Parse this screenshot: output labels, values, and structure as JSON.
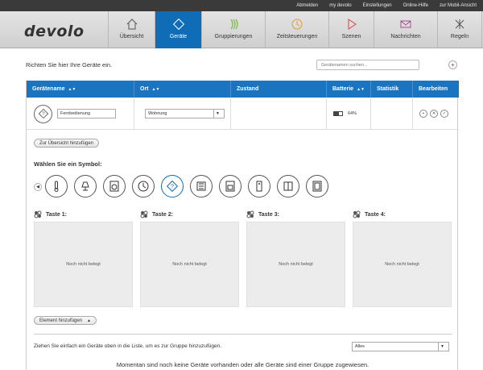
{
  "topbar": {
    "links": [
      "Abmelden",
      "my devolo",
      "Einstellungen",
      "Online-Hilfe",
      "zur Mobil-Ansicht"
    ]
  },
  "logo": "devolo",
  "tabs": [
    {
      "label": "Übersicht",
      "icon": "home-icon"
    },
    {
      "label": "Geräte",
      "icon": "device-icon",
      "active": true
    },
    {
      "label": "Gruppierungen",
      "icon": "groups-icon"
    },
    {
      "label": "Zeitsteuerungen",
      "icon": "clock-icon"
    },
    {
      "label": "Szenen",
      "icon": "play-icon"
    },
    {
      "label": "Nachrichten",
      "icon": "mail-icon"
    },
    {
      "label": "Regeln",
      "icon": "rules-icon"
    }
  ],
  "intro": "Richten Sie hier Ihre Geräte ein.",
  "search": {
    "placeholder": "Gerätenamen suchen..."
  },
  "table": {
    "headers": [
      "Gerätename",
      "Ort",
      "Zustand",
      "Batterie",
      "Statistik",
      "Bearbeiten"
    ],
    "row": {
      "name": "Fernbedienung",
      "location": "Wohnung",
      "battery_text": "64%",
      "battery_level": 0.64
    }
  },
  "add_overview_label": "Zur Übersicht hinzufügen",
  "symbols": {
    "title": "Wählen Sie ein Symbol:",
    "icons": [
      "thermometer-icon",
      "lamp-icon",
      "washer-icon",
      "clock-icon",
      "question-icon",
      "radiator-icon",
      "oven-icon",
      "remote-icon",
      "window-icon",
      "door-icon"
    ],
    "selected_index": 4
  },
  "keys": [
    {
      "label": "Taste 1:",
      "empty": "Noch nicht belegt"
    },
    {
      "label": "Taste 2:",
      "empty": "Noch nicht belegt"
    },
    {
      "label": "Taste 3:",
      "empty": "Noch nicht belegt"
    },
    {
      "label": "Taste 4:",
      "empty": "Noch nicht belegt"
    }
  ],
  "add_element_label": "Element hinzufügen",
  "group_hint": "Ziehen Sie einfach ein Geräte oben in die Liste, um es zur Gruppe hinzuzufügen.",
  "filter_select": "Alles",
  "footer_msg": "Momentan sind noch keine Geräte vorhanden oder alle Geräte sind einer Gruppe zugewiesen.",
  "colors": {
    "accent": "#0f6cb6",
    "header": "#1a74c0",
    "topbar": "#3a3a3a"
  }
}
